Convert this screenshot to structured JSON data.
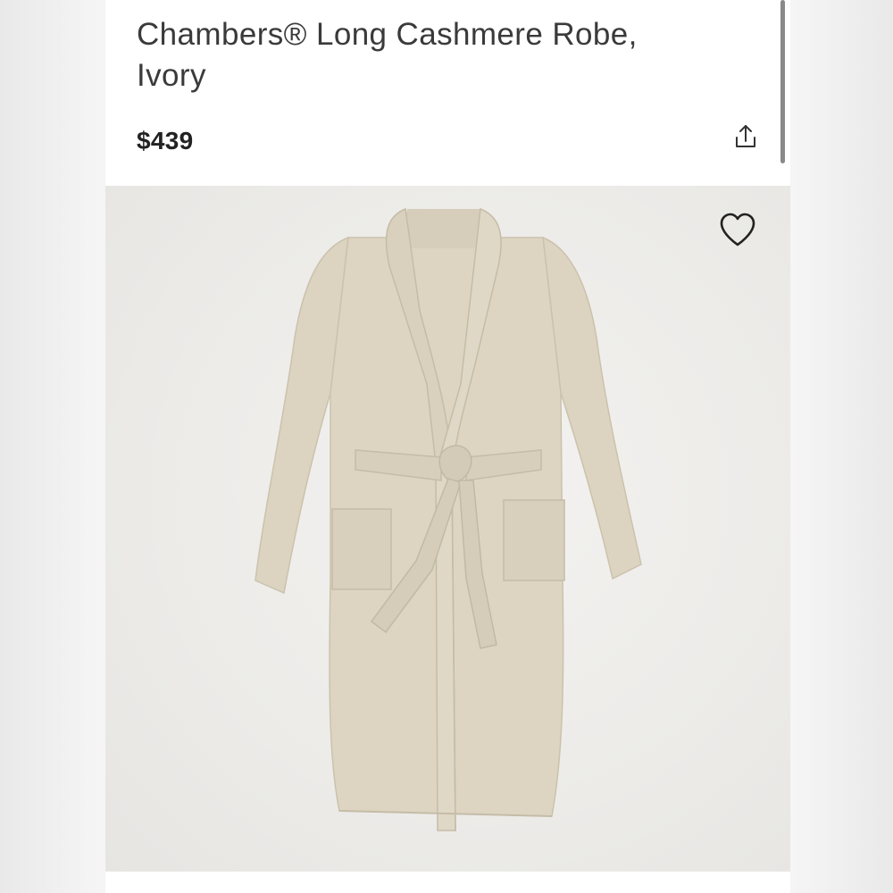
{
  "product": {
    "title_line1": "Chambers® Long Cashmere Robe,",
    "title_line2": "Ivory",
    "price": "$439"
  },
  "icons": {
    "share": "share-icon",
    "favorite": "heart-icon"
  },
  "colors": {
    "robe": "#ddd5c2",
    "robe_shadow": "#c9c0ab",
    "text": "#3a3a3a"
  },
  "product_image": {
    "alt": "Chambers Long Cashmere Robe in Ivory, shown laid flat with belt tied"
  }
}
